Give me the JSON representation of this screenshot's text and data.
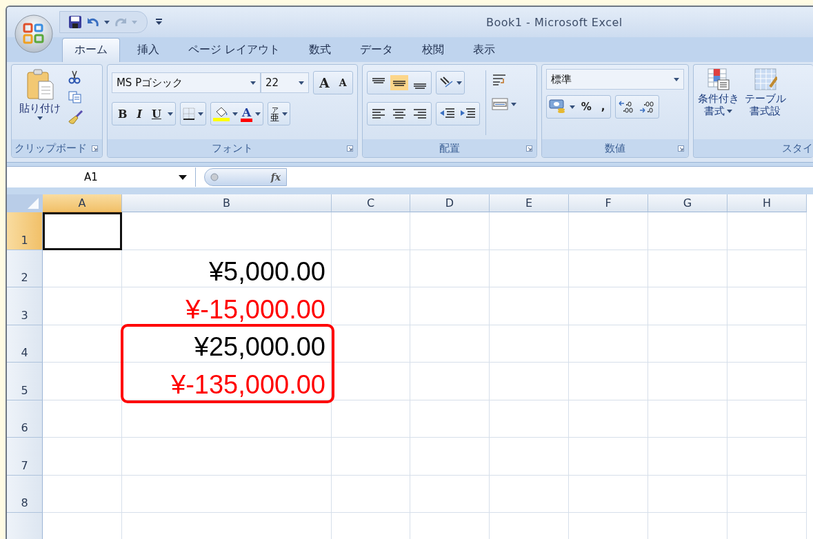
{
  "window": {
    "title": "Book1 - Microsoft Excel"
  },
  "tabs": [
    {
      "label": "ホーム",
      "selected": true
    },
    {
      "label": "挿入",
      "selected": false
    },
    {
      "label": "ページ レイアウト",
      "selected": false
    },
    {
      "label": "数式",
      "selected": false
    },
    {
      "label": "データ",
      "selected": false
    },
    {
      "label": "校閲",
      "selected": false
    },
    {
      "label": "表示",
      "selected": false
    }
  ],
  "ribbon": {
    "clipboard": {
      "label": "クリップボード",
      "paste": "貼り付け"
    },
    "font": {
      "label": "フォント",
      "font_name": "MS Pゴシック",
      "font_size": "22",
      "grow": "A",
      "shrink": "A",
      "bold": "B",
      "italic": "I",
      "underline": "U",
      "font_color": "A",
      "phonetic_ruby": "ア",
      "phonetic_base": "亜"
    },
    "alignment": {
      "label": "配置",
      "vertical": [
        {
          "selected": false
        },
        {
          "selected": true
        },
        {
          "selected": false
        }
      ]
    },
    "number": {
      "label": "数値",
      "format": "標準",
      "percent": "%",
      "comma": ","
    },
    "styles": {
      "label": "スタイ",
      "conditional": [
        "条件付き",
        "書式"
      ],
      "table": [
        "テーブル",
        "書式設"
      ]
    }
  },
  "formula_bar": {
    "name_box": "A1",
    "fx": "fx"
  },
  "columns": [
    {
      "label": "A",
      "selected": true
    },
    {
      "label": "B",
      "selected": false
    },
    {
      "label": "C",
      "selected": false
    },
    {
      "label": "D",
      "selected": false
    },
    {
      "label": "E",
      "selected": false
    },
    {
      "label": "F",
      "selected": false
    },
    {
      "label": "G",
      "selected": false
    },
    {
      "label": "H",
      "selected": false
    }
  ],
  "rows": [
    {
      "label": "1",
      "selected": true
    },
    {
      "label": "2",
      "selected": false,
      "B": {
        "text": "¥5,000.00",
        "color": "#000000",
        "highlighted": false
      }
    },
    {
      "label": "3",
      "selected": false,
      "B": {
        "text": "¥-15,000.00",
        "color": "#ff0000",
        "highlighted": false
      }
    },
    {
      "label": "4",
      "selected": false,
      "B": {
        "text": "¥25,000.00",
        "color": "#000000",
        "highlighted": true
      }
    },
    {
      "label": "5",
      "selected": false,
      "B": {
        "text": "¥-135,000.00",
        "color": "#ff0000",
        "highlighted": true
      }
    },
    {
      "label": "6",
      "selected": false
    },
    {
      "label": "7",
      "selected": false
    },
    {
      "label": "8",
      "selected": false
    }
  ]
}
